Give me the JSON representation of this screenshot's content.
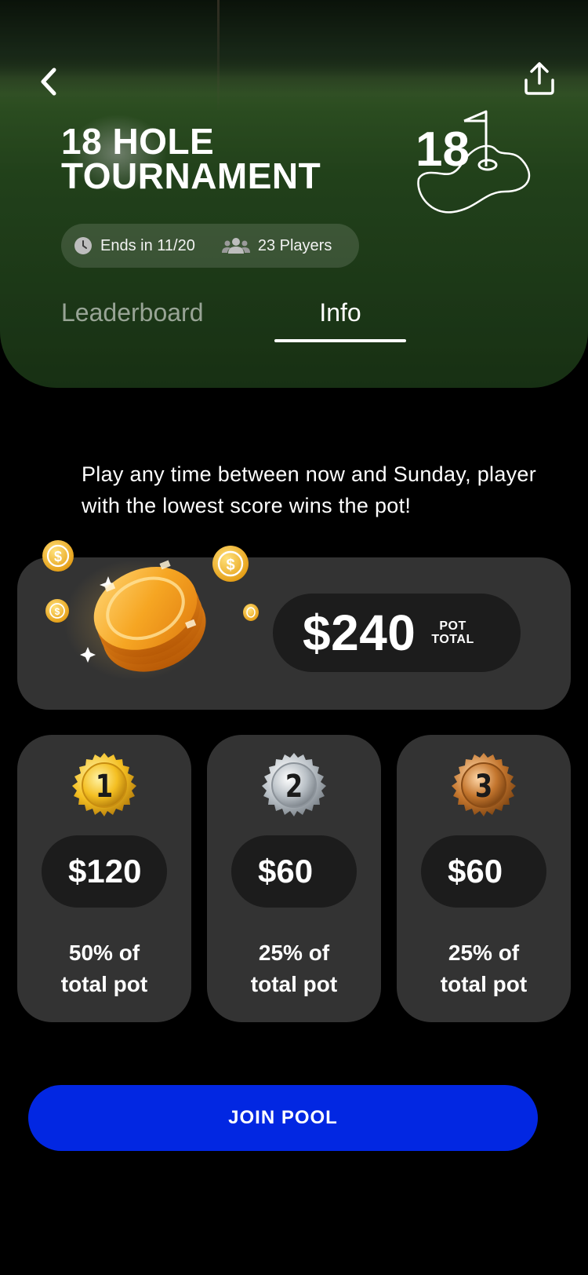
{
  "header": {
    "title_line1": "18 HOLE",
    "title_line2": "TOURNAMENT",
    "hole_number": "18",
    "ends": "Ends in 11/20",
    "players": "23 Players",
    "icons": {
      "back": "chevron-left-icon",
      "share": "share-icon",
      "clock": "clock-icon",
      "players": "users-icon",
      "hole": "golf-hole-flag-icon"
    }
  },
  "tabs": [
    {
      "label": "Leaderboard",
      "active": false
    },
    {
      "label": "Info",
      "active": true
    }
  ],
  "description": "Play any time between now and Sunday, player with the lowest score wins the pot!",
  "pot": {
    "amount": "$240",
    "label_line1": "POT",
    "label_line2": "TOTAL"
  },
  "prizes": [
    {
      "place": "1",
      "amount": "$120",
      "desc_line1": "50% of",
      "desc_line2": "total pot",
      "medal": "gold"
    },
    {
      "place": "2",
      "amount": "$60",
      "desc_line1": "25% of",
      "desc_line2": "total pot",
      "medal": "silver"
    },
    {
      "place": "3",
      "amount": "$60",
      "desc_line1": "25% of",
      "desc_line2": "total pot",
      "medal": "bronze"
    }
  ],
  "join_button": "JOIN POOL",
  "colors": {
    "background": "#000000",
    "card": "#333333",
    "pill": "#1c1c1c",
    "primary": "#0227e2",
    "gold": "#f3b820",
    "silver": "#c9ced3",
    "bronze": "#b86a2a"
  }
}
